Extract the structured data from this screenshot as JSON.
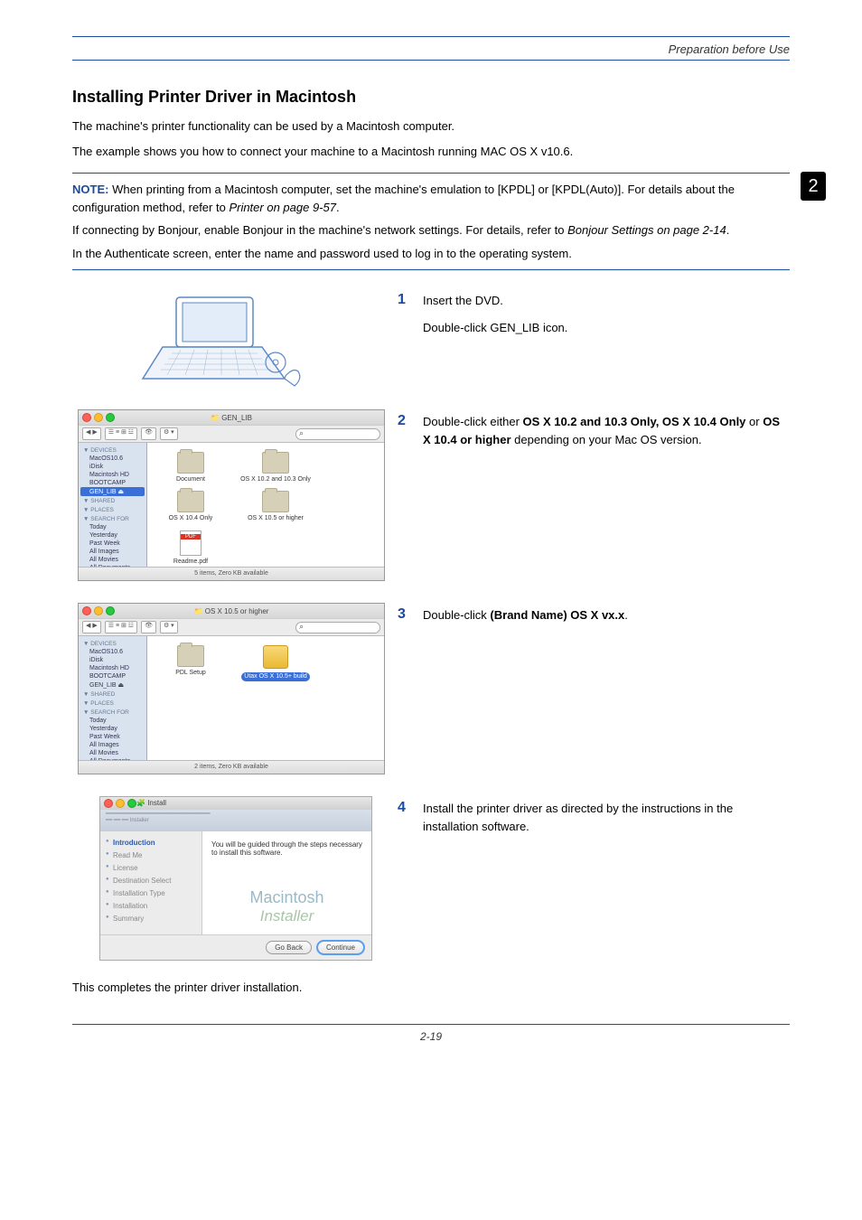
{
  "header": {
    "breadcrumb": "Preparation before Use"
  },
  "chapter_badge": "2",
  "title": "Installing Printer Driver in Macintosh",
  "intro": {
    "p1": "The machine's printer functionality can be used by a Macintosh computer.",
    "p2": "The example shows you how to connect your machine to a Macintosh running MAC OS X v10.6."
  },
  "note": {
    "label": "NOTE:",
    "p1a": " When printing from a Macintosh computer, set the machine's emulation to [KPDL] or [KPDL(Auto)]. For details about the configuration method, refer to ",
    "p1_em": "Printer on page 9-57",
    "p1b": ".",
    "p2a": "If connecting by Bonjour, enable Bonjour in the machine's network settings. For details, refer to ",
    "p2_em": "Bonjour Settings on page 2-14",
    "p2b": ".",
    "p3": "In the Authenticate screen, enter the name and password used to log in to the operating system."
  },
  "steps": [
    {
      "num": "1",
      "text1": "Insert the DVD.",
      "text2": "Double-click GEN_LIB icon."
    },
    {
      "num": "2",
      "t1": "Double-click either ",
      "b1": "OS X 10.2 and 10.3 Only, OS X 10.4 Only",
      "t2": " or ",
      "b2": "OS X 10.4 or higher",
      "t3": " depending on your Mac OS version."
    },
    {
      "num": "3",
      "t1": "Double-click ",
      "b1": "(Brand Name) OS X vx.x",
      "t2": "."
    },
    {
      "num": "4",
      "text1": "Install the printer driver as directed by the instructions in the installation software."
    }
  ],
  "closing": "This completes the printer driver installation.",
  "footer": "2-19",
  "finder1": {
    "title": "GEN_LIB",
    "sidebar": {
      "devices_h": "▼ DEVICES",
      "d1": "MacOS10.6",
      "d2": "iDisk",
      "d3": "Macintosh HD",
      "d4": "BOOTCAMP",
      "d5": "GEN_LIB",
      "shared_h": "▼ SHARED",
      "places_h": "▼ PLACES",
      "search_h": "▼ SEARCH FOR",
      "s1": "Today",
      "s2": "Yesterday",
      "s3": "Past Week",
      "s4": "All Images",
      "s5": "All Movies",
      "s6": "All Documents"
    },
    "icons": {
      "i1": "Document",
      "i2": "OS X 10.2 and 10.3 Only",
      "i3": "OS X 10.4 Only",
      "i4": "OS X 10.5 or higher",
      "i5": "Readme.pdf"
    },
    "status": "5 items, Zero KB available"
  },
  "finder2": {
    "title": "OS X 10.5 or higher",
    "icons": {
      "i1": "PDL Setup",
      "i2": "Utax OS X 10.5+ build"
    },
    "status": "2 items, Zero KB available"
  },
  "installer": {
    "title": "Install",
    "side": {
      "s1": "Introduction",
      "s2": "Read Me",
      "s3": "License",
      "s4": "Destination Select",
      "s5": "Installation Type",
      "s6": "Installation",
      "s7": "Summary"
    },
    "msg": "You will be guided through the steps necessary to install this software.",
    "logo1": "Macintosh",
    "logo2": "Installer",
    "btn_back": "Go Back",
    "btn_cont": "Continue"
  }
}
